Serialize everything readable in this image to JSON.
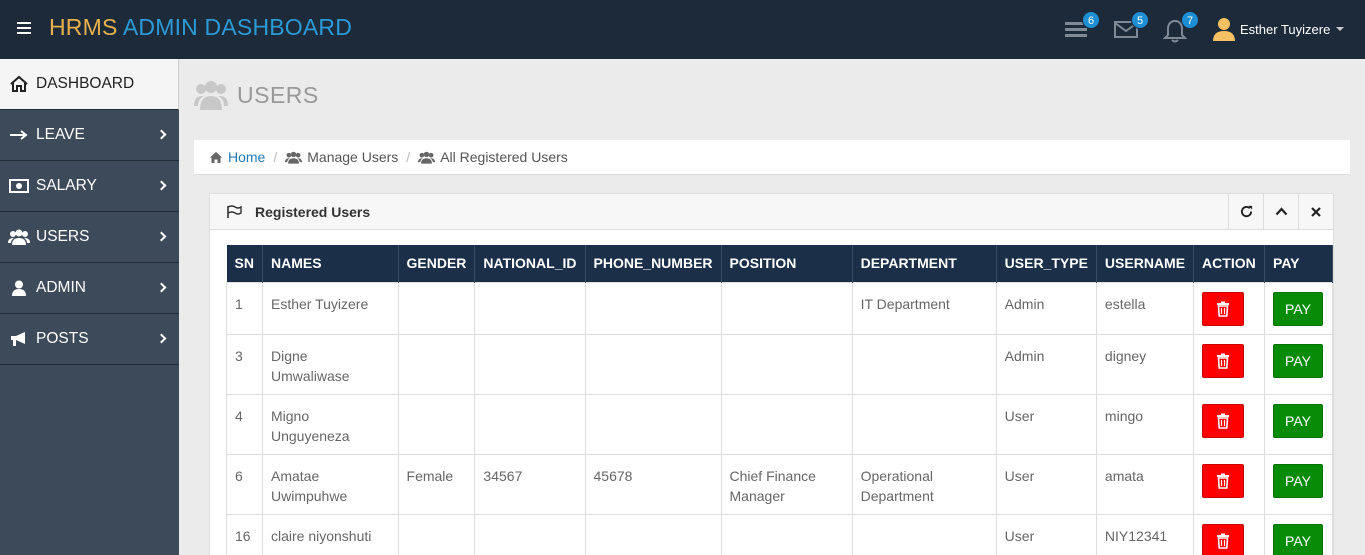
{
  "header": {
    "brand_part1": "HRMS",
    "brand_part2": "ADMIN DASHBOARD",
    "tasks_badge": "6",
    "messages_badge": "5",
    "notifications_badge": "7",
    "user_name": "Esther Tuyizere"
  },
  "sidebar": {
    "items": [
      {
        "label": "DASHBOARD",
        "icon": "home-icon"
      },
      {
        "label": "LEAVE",
        "icon": "arrow-right-icon"
      },
      {
        "label": "SALARY",
        "icon": "money-icon"
      },
      {
        "label": "USERS",
        "icon": "users-icon"
      },
      {
        "label": "ADMIN",
        "icon": "user-icon"
      },
      {
        "label": "POSTS",
        "icon": "bullhorn-icon"
      }
    ]
  },
  "page": {
    "title": "USERS"
  },
  "breadcrumb": {
    "home": "Home",
    "manage": "Manage Users",
    "current": "All Registered Users"
  },
  "panel": {
    "title": "Registered Users"
  },
  "table": {
    "headers": [
      "SN",
      "NAMES",
      "GENDER",
      "NATIONAL_ID",
      "PHONE_NUMBER",
      "POSITION",
      "DEPARTMENT",
      "USER_TYPE",
      "USERNAME",
      "ACTION",
      "PAY"
    ],
    "pay_label": "PAY",
    "rows": [
      {
        "sn": "1",
        "names": "Esther Tuyizere",
        "gender": "",
        "national_id": "",
        "phone": "",
        "position": "",
        "department": "IT Department",
        "user_type": "Admin",
        "username": "estella"
      },
      {
        "sn": "3",
        "names": "Digne Umwaliwase",
        "gender": "",
        "national_id": "",
        "phone": "",
        "position": "",
        "department": "",
        "user_type": "Admin",
        "username": "digney"
      },
      {
        "sn": "4",
        "names": "Migno Unguyeneza",
        "gender": "",
        "national_id": "",
        "phone": "",
        "position": "",
        "department": "",
        "user_type": "User",
        "username": "mingo"
      },
      {
        "sn": "6",
        "names": "Amatae Uwimpuhwe",
        "gender": "Female",
        "national_id": "34567",
        "phone": "45678",
        "position": "Chief Finance Manager",
        "department": "Operational Department",
        "user_type": "User",
        "username": "amata"
      },
      {
        "sn": "16",
        "names": "claire niyonshuti",
        "gender": "",
        "national_id": "",
        "phone": "",
        "position": "",
        "department": "",
        "user_type": "User",
        "username": "NIY12341"
      }
    ]
  }
}
